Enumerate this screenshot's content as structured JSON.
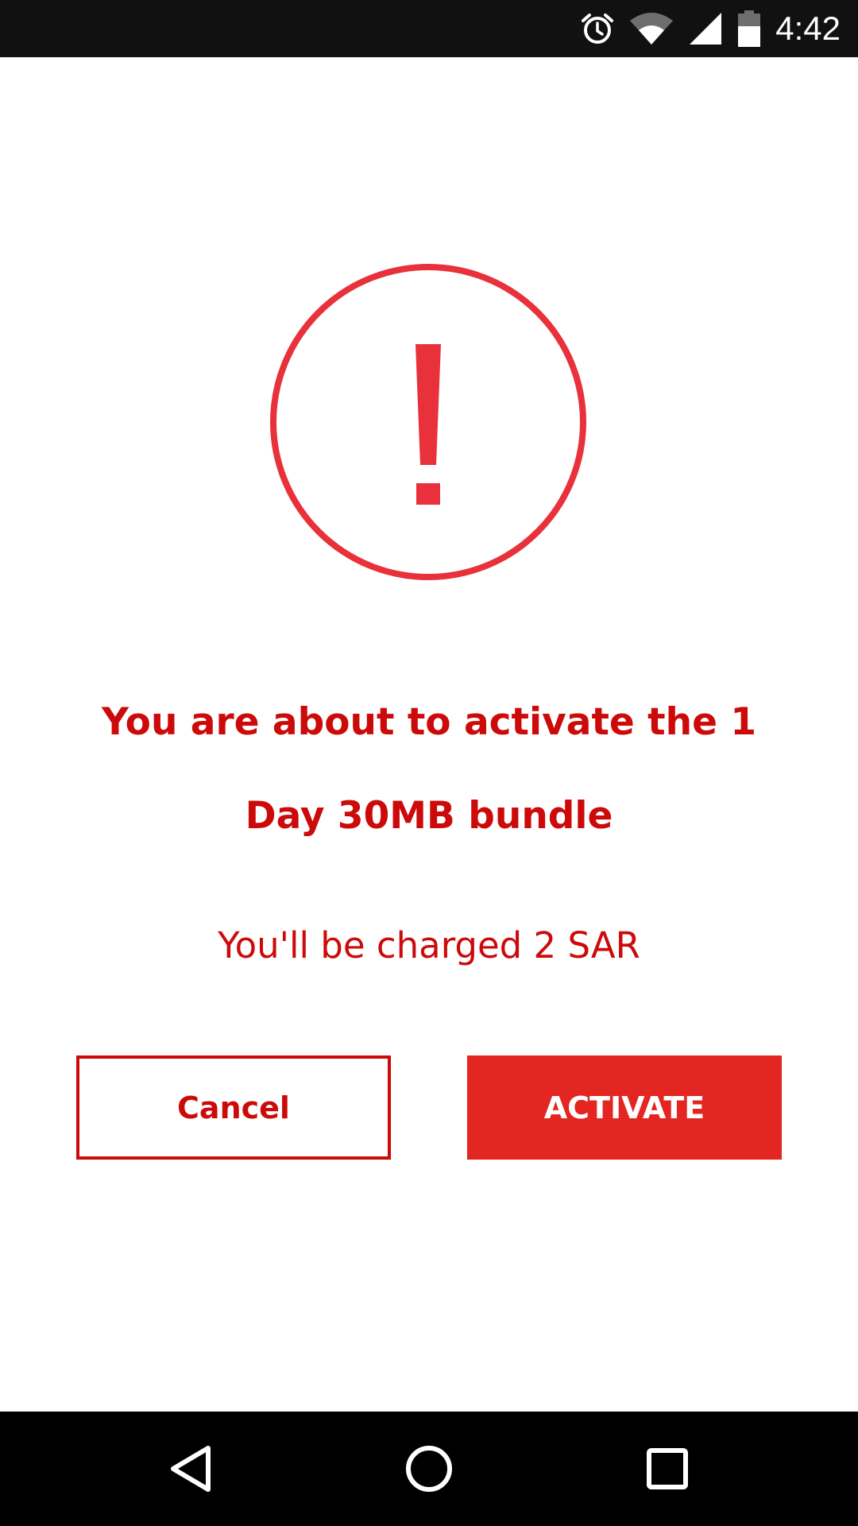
{
  "status_bar": {
    "time": "4:42",
    "icons": [
      "alarm-icon",
      "wifi-icon",
      "cell-signal-icon",
      "battery-icon"
    ]
  },
  "dialog": {
    "icon": "exclamation-circle-icon",
    "headline": "You are about to activate the 1 Day 30MB bundle",
    "charge_text": "You'll be charged 2 SAR",
    "cancel_label": "Cancel",
    "activate_label": "ACTIVATE"
  },
  "colors": {
    "accent_red": "#e32621",
    "text_red": "#cc0a0a",
    "icon_red": "#e8313a"
  },
  "nav_bar": {
    "buttons": [
      "back-icon",
      "home-icon",
      "recents-icon"
    ]
  }
}
